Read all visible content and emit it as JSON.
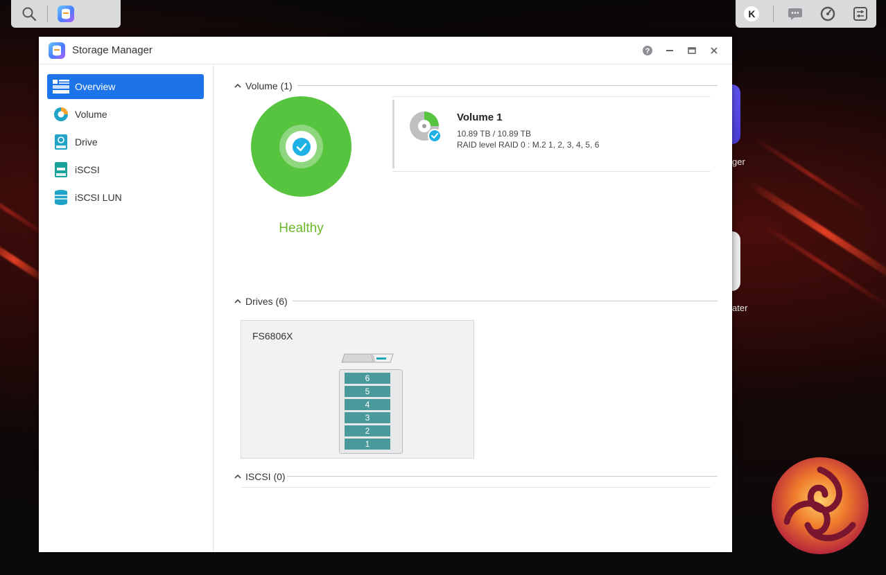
{
  "window": {
    "title": "Storage Manager"
  },
  "sidebar": {
    "items": [
      {
        "label": "Overview",
        "icon": "overview-icon",
        "active": true
      },
      {
        "label": "Volume",
        "icon": "volume-icon",
        "active": false
      },
      {
        "label": "Drive",
        "icon": "drive-icon",
        "active": false
      },
      {
        "label": "iSCSI",
        "icon": "iscsi-icon",
        "active": false
      },
      {
        "label": "iSCSI LUN",
        "icon": "iscsi-lun-icon",
        "active": false
      }
    ]
  },
  "taskbar": {
    "user_initial": "K"
  },
  "desktop": {
    "label_1": "ger",
    "label_2": "ater"
  },
  "overview": {
    "volume_section": "Volume (1)",
    "status": "Healthy",
    "volume": {
      "name": "Volume 1",
      "size": "10.89 TB / 10.89 TB",
      "raid": "RAID level RAID 0 : M.2 1, 2, 3, 4, 5, 6"
    },
    "drives_section": "Drives (6)",
    "device": {
      "model": "FS6806X",
      "slots": [
        "6",
        "5",
        "4",
        "3",
        "2",
        "1"
      ]
    },
    "iscsi_section": "ISCSI (0)"
  },
  "colors": {
    "accent": "#1d73e8",
    "healthy": "#57c440",
    "healthy_text": "#6ab82a",
    "slot": "#4a9a9c"
  }
}
